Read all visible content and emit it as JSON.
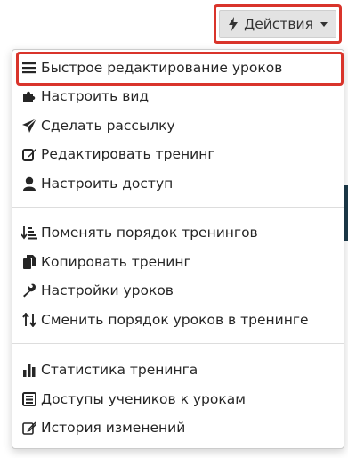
{
  "header": {
    "actions_label": "Действия"
  },
  "menu": {
    "groups": [
      [
        {
          "label": "Быстрое редактирование уроков",
          "icon": "bars-icon"
        },
        {
          "label": "Настроить вид",
          "icon": "puzzle-icon"
        },
        {
          "label": "Сделать рассылку",
          "icon": "paper-plane-icon"
        },
        {
          "label": "Редактировать тренинг",
          "icon": "edit-icon"
        },
        {
          "label": "Настроить доступ",
          "icon": "user-icon"
        }
      ],
      [
        {
          "label": "Поменять порядок тренингов",
          "icon": "sort-amount-icon"
        },
        {
          "label": "Копировать тренинг",
          "icon": "copy-icon"
        },
        {
          "label": "Настройки уроков",
          "icon": "wrench-icon"
        },
        {
          "label": "Сменить порядок уроков в тренинге",
          "icon": "sort-arrows-icon"
        }
      ],
      [
        {
          "label": "Статистика тренинга",
          "icon": "bar-chart-icon"
        },
        {
          "label": "Доступы учеников к урокам",
          "icon": "list-alt-icon"
        },
        {
          "label": "История изменений",
          "icon": "edit-outline-icon"
        }
      ]
    ]
  },
  "colors": {
    "highlight": "#d9342b",
    "button_bg": "#e3e3e3",
    "text": "#262626"
  }
}
